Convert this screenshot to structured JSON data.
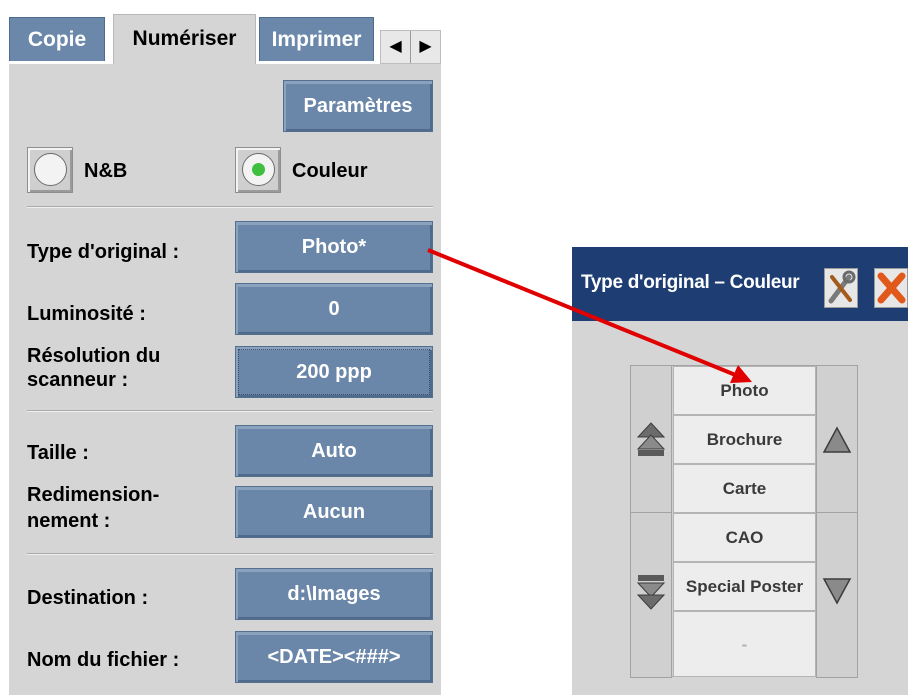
{
  "tabs": [
    {
      "label": "Copie",
      "active": false
    },
    {
      "label": "Numériser",
      "active": true
    },
    {
      "label": "Imprimer",
      "active": false
    }
  ],
  "tab_scroll": {
    "left": "◀",
    "right": "▶"
  },
  "settings_button": "Paramètres",
  "color_mode": {
    "bw_label": "N&B",
    "color_label": "Couleur",
    "selected": "Couleur"
  },
  "fields": {
    "original_type": {
      "label": "Type d'original :",
      "value": "Photo*"
    },
    "brightness": {
      "label": "Luminosité :",
      "value": "0"
    },
    "resolution": {
      "label_line1": "Résolution du",
      "label_line2": "scanneur :",
      "value": "200 ppp"
    },
    "size": {
      "label": "Taille :",
      "value": "Auto"
    },
    "resize": {
      "label_line1": "Redimension-",
      "label_line2": "nement  :",
      "value": "Aucun"
    },
    "destination": {
      "label": "Destination :",
      "value": "d:\\Images"
    },
    "filename": {
      "label": "Nom du fichier :",
      "value": "<DATE><###>"
    }
  },
  "dialog": {
    "title": "Type d'original – Couleur",
    "items": [
      "Photo",
      "Brochure",
      "Carte",
      "CAO",
      "Special Poster",
      "-"
    ]
  },
  "colors": {
    "button_blue": "#6a86a8",
    "dialog_title_bar": "#1d3d73",
    "annotation_arrow": "#e00000",
    "radio_selected": "#3fbf3f"
  }
}
